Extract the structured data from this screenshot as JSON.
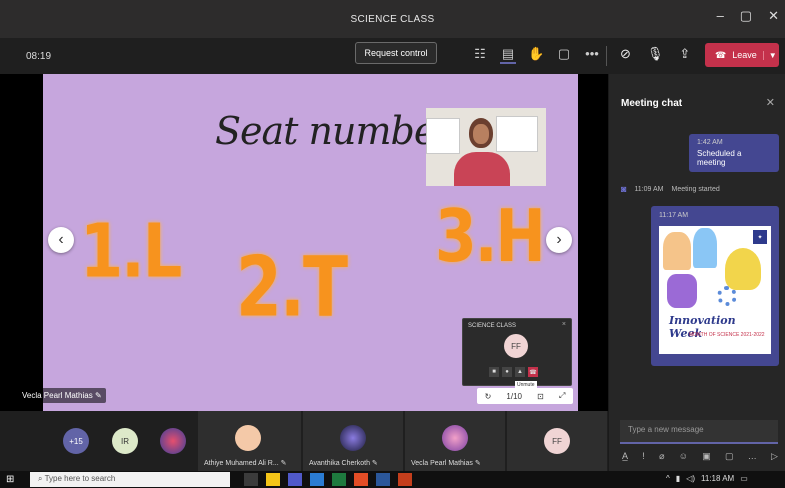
{
  "window": {
    "title": "SCIENCE CLASS",
    "controls": [
      "–",
      "▢",
      "✕"
    ]
  },
  "toolbar": {
    "timer": "08:19",
    "request_control": "Request control",
    "icons": [
      "people-icon",
      "chat-icon",
      "raise-hand-icon",
      "rooms-icon",
      "more-icon"
    ],
    "leave_label": "Leave"
  },
  "slide": {
    "title": "Seat number",
    "items": [
      "1.L",
      "2.T",
      "3.H"
    ],
    "presenter_name": "Vecla Pearl Mathias"
  },
  "mini_call": {
    "title": "SCIENCE CLASS",
    "initials": "FF",
    "tooltip": "Unmute"
  },
  "zoom": {
    "value": "1/10"
  },
  "chat": {
    "title": "Meeting chat",
    "messages": [
      {
        "time": "1:42 AM",
        "text": "Scheduled a meeting"
      }
    ],
    "system": {
      "time": "11:09 AM",
      "text": "Meeting started"
    },
    "image_message": {
      "time": "11:17 AM",
      "poster_title": "Innovation Week",
      "poster_sub": "MONTH OF SCIENCE 2021-2022"
    },
    "compose_placeholder": "Type a new message"
  },
  "gallery": {
    "overflow_count": "+15",
    "initials_ir": "IR",
    "participants": [
      {
        "name": "Athiye Muhamed Ali R..."
      },
      {
        "name": "Avanthika Cherkoth"
      },
      {
        "name": "Vecla Pearl Mathias"
      }
    ],
    "initials_ff": "FF"
  },
  "taskbar": {
    "search_placeholder": "Type here to search",
    "clock": "11:18 AM"
  }
}
